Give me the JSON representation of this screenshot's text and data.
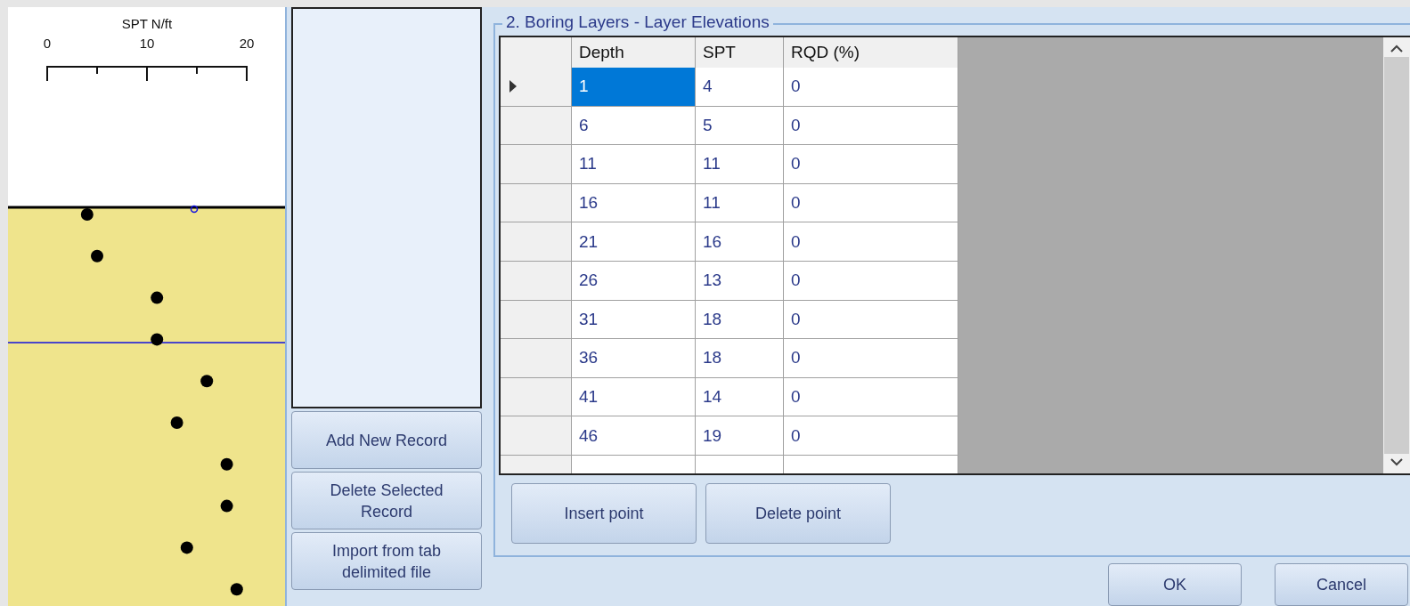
{
  "spt_plot": {
    "title": "SPT N/ft",
    "tick_labels": [
      "0",
      "10",
      "20"
    ]
  },
  "records": {
    "buttons": [
      "Add New Record",
      "Delete Selected Record",
      "Import from tab delimited file"
    ]
  },
  "boring_layers": {
    "title": "2. Boring Layers - Layer Elevations",
    "columns": [
      "Depth",
      "SPT",
      "RQD (%)"
    ],
    "rows": [
      {
        "cells": [
          "1",
          "4",
          "0"
        ],
        "selected": true
      },
      {
        "cells": [
          "6",
          "5",
          "0"
        ],
        "selected": false
      },
      {
        "cells": [
          "11",
          "11",
          "0"
        ],
        "selected": false
      },
      {
        "cells": [
          "16",
          "11",
          "0"
        ],
        "selected": false
      },
      {
        "cells": [
          "21",
          "16",
          "0"
        ],
        "selected": false
      },
      {
        "cells": [
          "26",
          "13",
          "0"
        ],
        "selected": false
      },
      {
        "cells": [
          "31",
          "18",
          "0"
        ],
        "selected": false
      },
      {
        "cells": [
          "36",
          "18",
          "0"
        ],
        "selected": false
      },
      {
        "cells": [
          "41",
          "14",
          "0"
        ],
        "selected": false
      },
      {
        "cells": [
          "46",
          "19",
          "0"
        ],
        "selected": false
      }
    ],
    "buttons": [
      "Insert point",
      "Delete point"
    ]
  },
  "dialog_buttons": [
    "OK",
    "Cancel"
  ]
}
